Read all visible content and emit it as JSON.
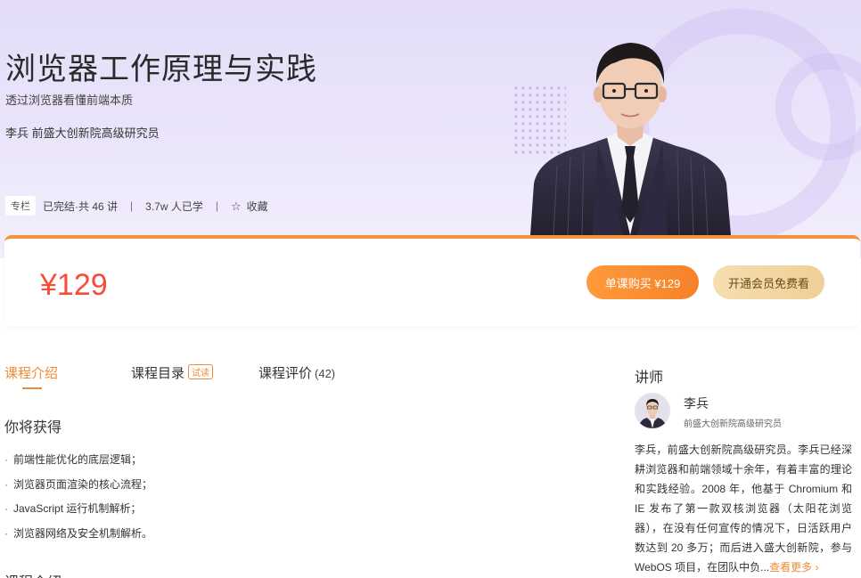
{
  "course": {
    "title": "浏览器工作原理与实践",
    "subtitle": "透过浏览器看懂前端本质",
    "author": "李兵 前盛大创新院高级研究员",
    "tag": "专栏",
    "lessons": "已完结·共 46 讲",
    "learners": "3.7w 人已学",
    "favorite": "收藏",
    "separator": "|"
  },
  "purchase": {
    "price": "¥129",
    "buy_label": "单课购买 ¥129",
    "vip_label": "开通会员免费看"
  },
  "tabs": [
    {
      "label": "课程介绍"
    },
    {
      "label": "课程目录",
      "badge": "试读"
    },
    {
      "label": "课程评价",
      "count": "(42)"
    }
  ],
  "gains": {
    "title": "你将获得",
    "bullet": "·",
    "items": [
      "前端性能优化的底层逻辑；",
      "浏览器页面渲染的核心流程；",
      "JavaScript 运行机制解析；",
      "浏览器网络及安全机制解析。"
    ]
  },
  "next_section": {
    "title": "课程介绍"
  },
  "teacher": {
    "heading": "讲师",
    "name": "李兵",
    "role": "前盛大创新院高级研究员",
    "bio": "李兵，前盛大创新院高级研究员。李兵已经深耕浏览器和前端领域十余年，有着丰富的理论和实践经验。2008 年，他基于 Chromium 和 IE 发布了第一款双核浏览器（太阳花浏览器），在没有任何宣传的情况下，日活跃用户数达到 20 多万；而后进入盛大创新院，参与 WebOS 项目，在团队中负...",
    "more": "查看更多 ›"
  },
  "colors": {
    "accent": "#f08a36",
    "price": "#fa4a3a",
    "hero_bg": "#e3dcf8",
    "vip": "#efcf96"
  }
}
